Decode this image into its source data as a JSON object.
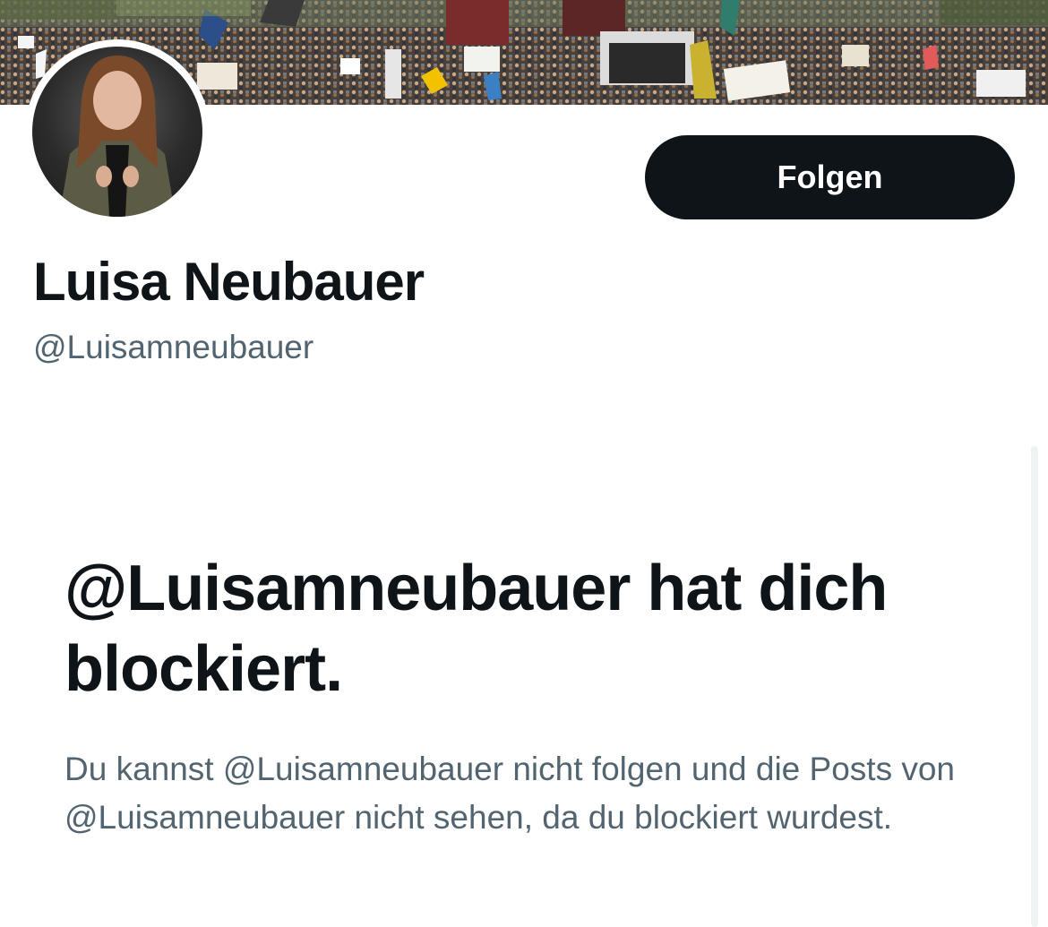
{
  "profile": {
    "display_name": "Luisa Neubauer",
    "handle": "@Luisamneubauer",
    "follow_label": "Folgen"
  },
  "blocked": {
    "title": "@Luisamneubauer hat dich blockiert.",
    "description": "Du kannst @Luisamneubauer nicht folgen und die Posts von @Luisamneubauer nicht sehen, da du blockiert wurdest."
  },
  "colors": {
    "text_primary": "#0f1419",
    "text_secondary": "#536471",
    "button_bg": "#0f1419",
    "button_text": "#ffffff"
  }
}
